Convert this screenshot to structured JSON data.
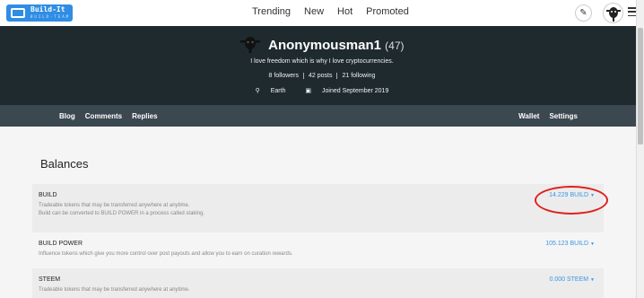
{
  "header": {
    "logo_text": "Build-It",
    "logo_sub": "BUILD-TEAM",
    "menu": [
      "Trending",
      "New",
      "Hot",
      "Promoted"
    ]
  },
  "profile": {
    "username": "Anonymousman1",
    "reputation": "(47)",
    "about": "I love freedom which is why I love cryptocurrencies.",
    "followers": "8 followers",
    "posts": "42 posts",
    "following": "21 following",
    "location": "Earth",
    "joined": "Joined September 2019"
  },
  "subnav": {
    "left": [
      "Blog",
      "Comments",
      "Replies"
    ],
    "right": [
      "Wallet",
      "Settings"
    ]
  },
  "balances": {
    "heading": "Balances",
    "rows": [
      {
        "title": "BUILD",
        "desc1": "Tradeable tokens that may be transferred anywhere at anytime.",
        "desc2": "Build can be converted to BUILD POWER in a process called staking.",
        "value": "14.229 BUILD"
      },
      {
        "title": "BUILD POWER",
        "desc1": "Influence tokens which give you more control over post payouts and allow you to earn on curation rewards.",
        "desc2": "",
        "value": "105.123 BUILD"
      },
      {
        "title": "STEEM",
        "desc1": "Tradeable tokens that may be transferred anywhere at anytime.",
        "desc2": "",
        "value": "0.000 STEEM"
      }
    ]
  },
  "colors": {
    "accent": "#3a95e8",
    "cover": "#1f2a2f",
    "annotation": "#e02020"
  }
}
